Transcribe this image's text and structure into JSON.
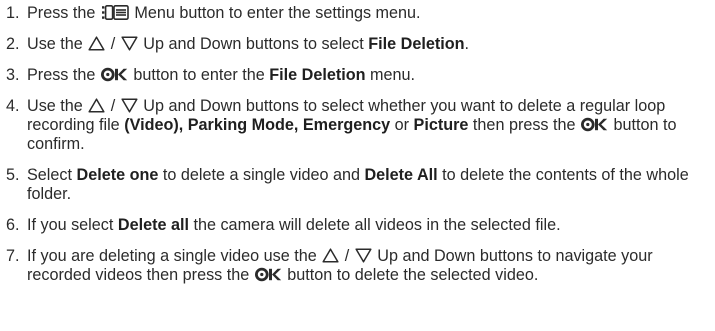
{
  "steps": [
    {
      "number": "1.",
      "parts": [
        {
          "t": "text",
          "v": "Press the "
        },
        {
          "t": "icon",
          "v": "menu-icon"
        },
        {
          "t": "text",
          "v": " Menu button to enter the settings menu."
        }
      ]
    },
    {
      "number": "2.",
      "parts": [
        {
          "t": "text",
          "v": "Use the "
        },
        {
          "t": "icon",
          "v": "up-triangle-icon"
        },
        {
          "t": "text",
          "v": " / "
        },
        {
          "t": "icon",
          "v": "down-triangle-icon"
        },
        {
          "t": "text",
          "v": " Up and Down buttons to select "
        },
        {
          "t": "bold",
          "v": "File Deletion"
        },
        {
          "t": "text",
          "v": "."
        }
      ]
    },
    {
      "number": "3.",
      "parts": [
        {
          "t": "text",
          "v": " Press the "
        },
        {
          "t": "icon",
          "v": "ok-icon"
        },
        {
          "t": "text",
          "v": " button to enter the "
        },
        {
          "t": "bold",
          "v": "File Deletion"
        },
        {
          "t": "text",
          "v": " menu."
        }
      ]
    },
    {
      "number": "4.",
      "parts": [
        {
          "t": "text",
          "v": "Use the "
        },
        {
          "t": "icon",
          "v": "up-triangle-icon"
        },
        {
          "t": "text",
          "v": " / "
        },
        {
          "t": "icon",
          "v": "down-triangle-icon"
        },
        {
          "t": "text",
          "v": " Up and Down buttons to select whether you want to delete a regular loop recording file "
        },
        {
          "t": "bold",
          "v": "(Video), Parking Mode, Emergency"
        },
        {
          "t": "text",
          "v": " or "
        },
        {
          "t": "bold",
          "v": "Picture"
        },
        {
          "t": "text",
          "v": " then press the "
        },
        {
          "t": "icon",
          "v": "ok-icon"
        },
        {
          "t": "text",
          "v": " button to confirm."
        }
      ]
    },
    {
      "number": "5.",
      "parts": [
        {
          "t": "text",
          "v": "Select "
        },
        {
          "t": "bold",
          "v": "Delete one"
        },
        {
          "t": "text",
          "v": " to delete a single video and "
        },
        {
          "t": "bold",
          "v": "Delete All"
        },
        {
          "t": "text",
          "v": " to delete the contents of the whole folder."
        }
      ]
    },
    {
      "number": "6.",
      "parts": [
        {
          "t": "text",
          "v": "If you select "
        },
        {
          "t": "bold",
          "v": "Delete all"
        },
        {
          "t": "text",
          "v": " the camera will delete all videos in the selected file."
        }
      ]
    },
    {
      "number": "7.",
      "parts": [
        {
          "t": "text",
          "v": "If you are deleting a single video use the "
        },
        {
          "t": "icon",
          "v": "up-triangle-icon"
        },
        {
          "t": "text",
          "v": " / "
        },
        {
          "t": "icon",
          "v": "down-triangle-icon"
        },
        {
          "t": "text",
          "v": " Up and Down buttons to navigate your recorded videos then press the "
        },
        {
          "t": "icon",
          "v": "ok-icon"
        },
        {
          "t": "text",
          "v": " button to delete the selected video."
        }
      ]
    }
  ]
}
